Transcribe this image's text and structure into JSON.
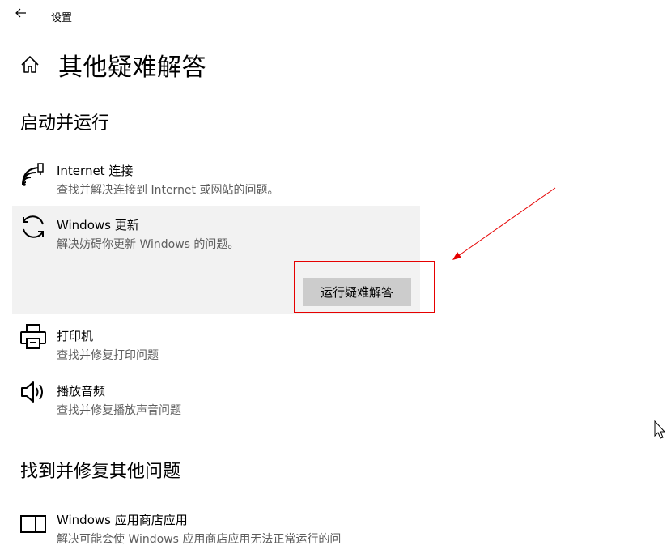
{
  "app_title": "设置",
  "page_title": "其他疑难解答",
  "sections": {
    "run": {
      "title": "启动并运行",
      "items": [
        {
          "title": "Internet 连接",
          "desc": "查找并解决连接到 Internet 或网站的问题。",
          "icon": "wifi-icon"
        },
        {
          "title": "Windows 更新",
          "desc": "解决妨碍你更新 Windows 的问题。",
          "icon": "sync-icon",
          "button": "运行疑难解答"
        },
        {
          "title": "打印机",
          "desc": "查找并修复打印问题",
          "icon": "printer-icon"
        },
        {
          "title": "播放音频",
          "desc": "查找并修复播放声音问题",
          "icon": "speaker-icon"
        }
      ]
    },
    "other": {
      "title": "找到并修复其他问题",
      "items": [
        {
          "title": "Windows 应用商店应用",
          "desc": "解决可能会使 Windows 应用商店应用无法正常运行的问",
          "icon": "store-app-icon"
        }
      ]
    }
  },
  "colors": {
    "highlight": "#e60000",
    "expanded_bg": "#f2f2f2",
    "button_bg": "#cccccc",
    "desc_text": "#5d5d5d"
  }
}
